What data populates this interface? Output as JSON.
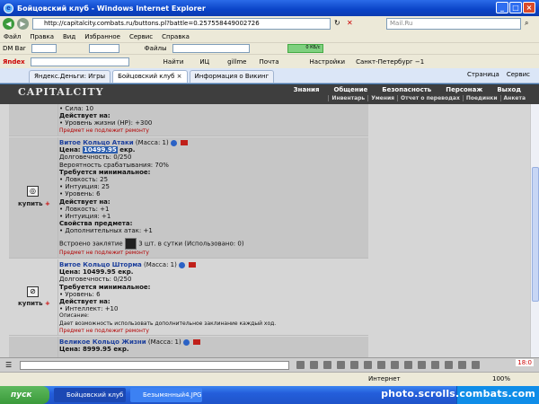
{
  "window": {
    "title": "Бойцовский клуб - Windows Internet Explorer",
    "url": "http://capitalcity.combats.ru/buttons.pl?battle=0.257558449002726",
    "search_placeholder": "Mail.Ru"
  },
  "menu": [
    "Файл",
    "Правка",
    "Вид",
    "Избранное",
    "Сервис",
    "Справка"
  ],
  "toolbar_dm": {
    "label": "DM Bar",
    "files_label": "Файлы",
    "counter": "0 КБ/с"
  },
  "toolbar_yandex": {
    "logo": "Яndex",
    "find_label": "Найти",
    "ic_label": "ИЦ",
    "gillme_label": "gillme",
    "mail_label": "Почта",
    "settings_label": "Настройки",
    "city_label": "Санкт-Петербург −1"
  },
  "tabs": [
    {
      "label": "Яндекс.Деньги: Игры",
      "active": false
    },
    {
      "label": "Бойцовский клуб",
      "active": true
    },
    {
      "label": "Информация о Викинг",
      "active": false
    }
  ],
  "tab_actions": [
    "Страница",
    "Сервис"
  ],
  "site": {
    "logo": "CAPITALCITY",
    "nav_main": [
      "Знания",
      "Общение",
      "Безопасность",
      "Персонаж",
      "Выход"
    ],
    "nav_sub": [
      "Инвентарь",
      "Умения",
      "Отчет о переводах",
      "Поединки",
      "Анкета"
    ]
  },
  "items": [
    {
      "lines_top": [
        "• Сила: 10"
      ],
      "acts_label": "Действует на:",
      "acts": [
        "• Уровень жизни (HP): +300"
      ],
      "no_repair": "Предмет не подлежит ремонту"
    },
    {
      "name": "Витое Кольцо Атаки",
      "mass": "(Масса: 1)",
      "price_label": "Цена:",
      "price": "10499.95",
      "price_unit": "екр.",
      "durability": "Долговечность: 0/250",
      "chance": "Вероятность срабатывания: 70%",
      "req_label": "Требуется минимальное:",
      "reqs": [
        "• Ловкость: 25",
        "• Интуиция: 25",
        "• Уровень: 6"
      ],
      "acts_label": "Действует на:",
      "acts": [
        "• Ловкость: +1",
        "• Интуиция: +1"
      ],
      "props_label": "Свойства предмета:",
      "props": [
        "• Дополнительных атак: +1"
      ],
      "spell_prefix": "Встроено заклятие",
      "spell_suffix": "3 шт. в сутки (Использовано: 0)",
      "no_repair": "Предмет не подлежит ремонту",
      "buy_label": "купить"
    },
    {
      "name": "Витое Кольцо Шторма",
      "mass": "(Масса: 1)",
      "price_text": "Цена: 10499.95 екр.",
      "durability": "Долговечность: 0/250",
      "req_label": "Требуется минимальное:",
      "reqs": [
        "• Уровень: 6"
      ],
      "acts_label": "Действует на:",
      "acts": [
        "• Интеллект: +10"
      ],
      "desc_label": "Описание:",
      "desc": "Дает возможность использовать дополнительное заклинание каждый ход.",
      "no_repair": "Предмет не подлежит ремонту",
      "buy_label": "купить"
    },
    {
      "name": "Великое Кольцо Жизни",
      "mass": "(Масса: 1)",
      "price_text": "Цена: 8999.95 екр."
    }
  ],
  "chat": {
    "clock": "18:0"
  },
  "statusbar": {
    "zone": "Интернет",
    "zoom": "100%"
  },
  "taskbar": {
    "start": "пуск",
    "tasks": [
      "Бойцовский клуб - ...",
      "Безымянный4.JPG - ..."
    ],
    "watermark": "photo.scrolls.combats.com"
  }
}
